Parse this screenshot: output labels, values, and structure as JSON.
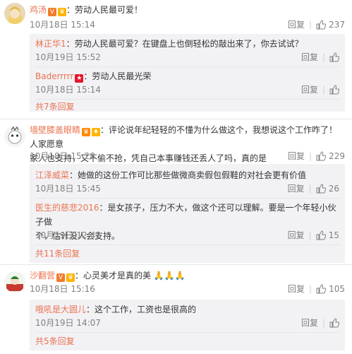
{
  "colors": {
    "link": "#eb7350",
    "meta": "#808080",
    "reply_bg": "#f2f2f5"
  },
  "actions": {
    "reply": "回复"
  },
  "comments": [
    {
      "user": "鸡汤",
      "text": "：劳动人民最可爱！",
      "time": "10月18日 15:14",
      "likes": "237",
      "replies": [
        {
          "user": "林正华1",
          "text": "：劳动人民最可爱？在键盘上也倒轻松的敲出来了，你去试试？",
          "time": "10月19日 15:52"
        },
        {
          "user": "Baderrrrr",
          "text": "：劳动人民最光荣",
          "time": "10月18日 15:14"
        }
      ],
      "more": "共7条回复"
    },
    {
      "user": "墙壁膝盖眼睛",
      "text_line1": "：评论说年纪轻轻的不懂为什么做这个，我想说这个工作咋了！人家愿意",
      "text_line2": "家人也支持，又不偷不抢，凭自己本事赚钱还丢人了吗，真的是",
      "time": "10月18日 15:28",
      "likes": "229",
      "replies": [
        {
          "user": "江泽威菜",
          "text": "：她做的这份工作可比那些做微商卖假包假鞋的对社会更有价值",
          "time": "10月18日 15:45",
          "likes": "26"
        },
        {
          "user": "医生的慈悲2016",
          "text_line1": "：是女孩子，压力不大，做这个还可以理解。要是一个年轻小伙子做",
          "text_line2": "个，估计没人会支持。",
          "time": "10月19日 12:41",
          "likes": "15"
        }
      ],
      "more": "共11条回复"
    },
    {
      "user": "沙翻营",
      "text": "：心灵美才是真的美",
      "time": "10月18日 15:16",
      "likes": "105",
      "replies": [
        {
          "user": "哦吼是大圆儿",
          "text": "：这个工作，工资也是很高的",
          "time": "10月19日 14:07"
        }
      ],
      "more": "共5条回复"
    }
  ]
}
